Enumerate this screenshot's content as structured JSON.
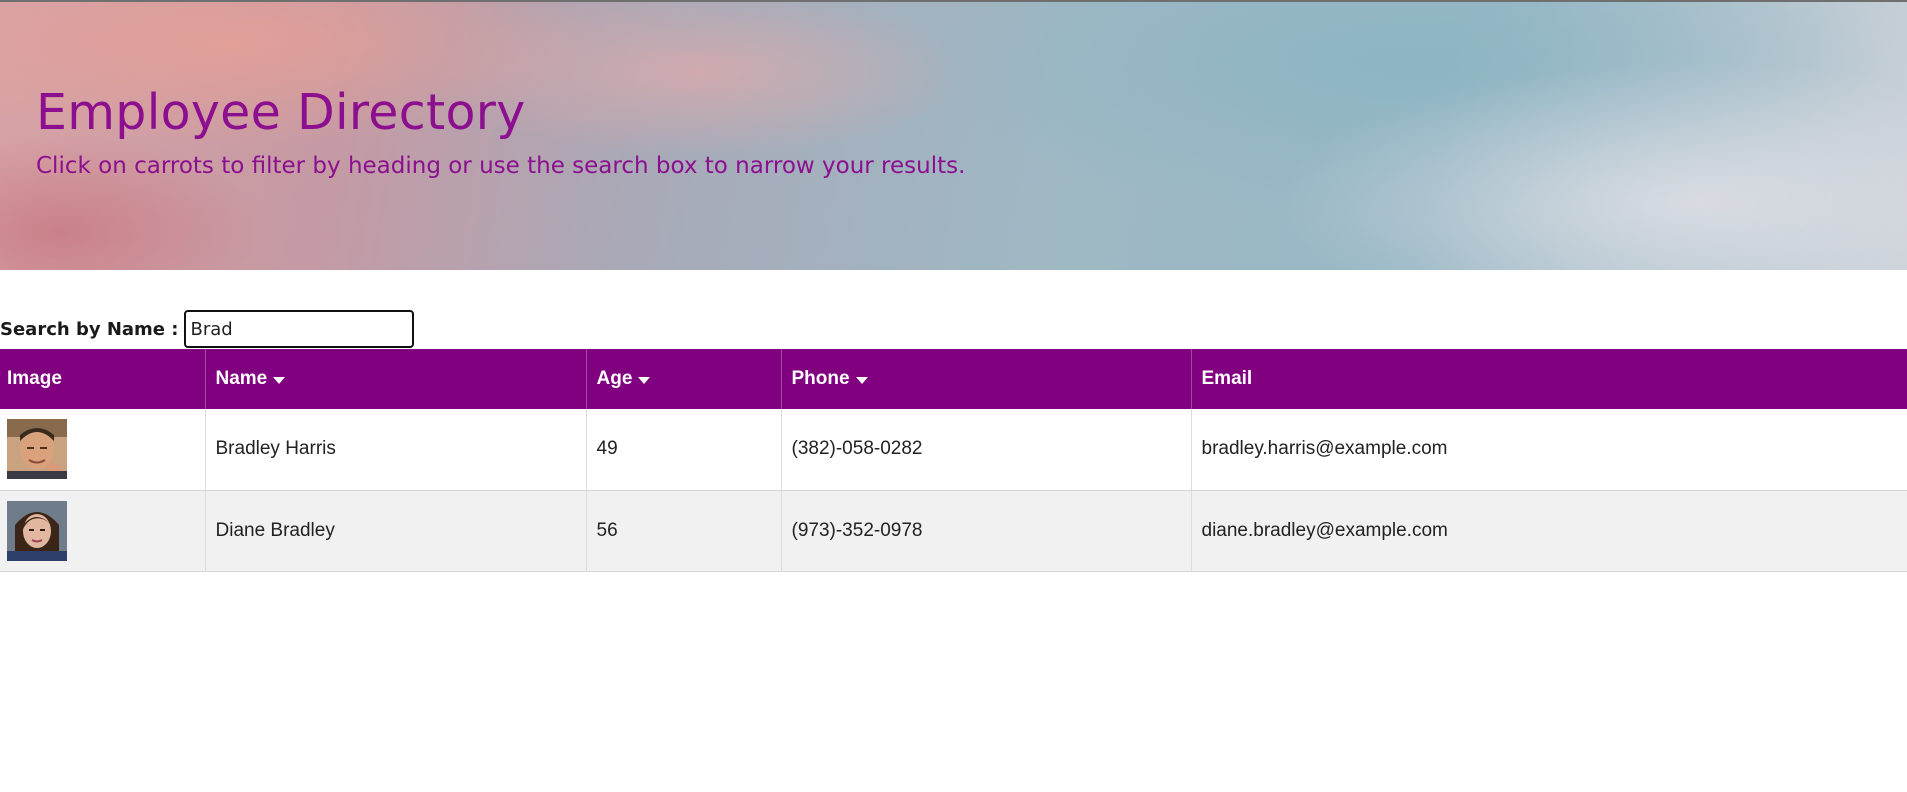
{
  "header": {
    "title": "Employee Directory",
    "subtitle": "Click on carrots to filter by heading or use the search box to narrow your results."
  },
  "search": {
    "label": "Search by Name :",
    "value": "Brad",
    "placeholder": ""
  },
  "table": {
    "columns": [
      {
        "label": "Image",
        "sortable": false
      },
      {
        "label": "Name",
        "sortable": true
      },
      {
        "label": "Age",
        "sortable": true
      },
      {
        "label": "Phone",
        "sortable": true
      },
      {
        "label": "Email",
        "sortable": false
      }
    ],
    "rows": [
      {
        "name": "Bradley Harris",
        "age": "49",
        "phone": "(382)-058-0282",
        "email": "bradley.harris@example.com"
      },
      {
        "name": "Diane Bradley",
        "age": "56",
        "phone": "(973)-352-0978",
        "email": "diane.bradley@example.com"
      }
    ]
  },
  "colors": {
    "accent": "#800080",
    "title": "#8b0f8e",
    "row_alt": "#f1f1f1"
  }
}
